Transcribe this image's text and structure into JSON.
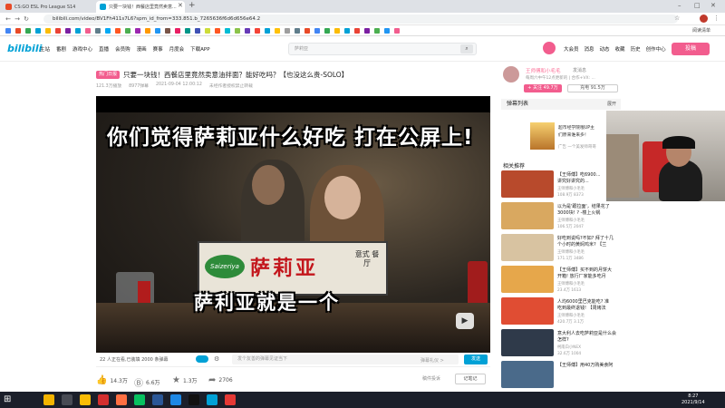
{
  "browser": {
    "tabs": [
      {
        "label": "CS:GO ESL Pro League S14",
        "color": "#e84a27"
      },
      {
        "label": "只要一块钱！西餐店里竟然卖意...",
        "color": "#00a1d6"
      }
    ],
    "url": "bilibili.com/video/BV1Fh411s7L6?spm_id_from=333.851.b_7265636f6d6d656e64.2",
    "bookmark_colors": [
      "#4285f4",
      "#e84a27",
      "#34a853",
      "#00a1d6",
      "#fbbc05",
      "#ea4335",
      "#7b1fa2",
      "#00a1d6",
      "#f25d8e",
      "#607d8b",
      "#03a9f4",
      "#ff5722",
      "#4caf50",
      "#9c27b0",
      "#ff9800",
      "#2196f3",
      "#795548",
      "#e91e63",
      "#009688",
      "#3f51b5",
      "#cddc39",
      "#ff5722",
      "#00bcd4",
      "#8bc34a",
      "#673ab7",
      "#f44336",
      "#00a1d6",
      "#ffc107",
      "#9e9e9e",
      "#607d8b",
      "#e84a27",
      "#4285f4",
      "#34a853",
      "#fbbc05",
      "#00a1d6",
      "#ea4335",
      "#7b1fa2",
      "#4caf50",
      "#2196f3",
      "#f25d8e"
    ],
    "reading_list": "阅读清单"
  },
  "header": {
    "logo": "bilibili",
    "nav": [
      "主站",
      "番剧",
      "游戏中心",
      "直播",
      "会员购",
      "漫画",
      "赛事",
      "月度会",
      "下载APP"
    ],
    "search_placeholder": "萨莉亚",
    "right_nav": [
      "大会员",
      "消息",
      "动态",
      "收藏",
      "历史",
      "创作中心"
    ],
    "upload": "投稿"
  },
  "video": {
    "badge": "热门日报",
    "title": "只要一块钱！西餐店里竟然卖意油拌面？能好吃吗？【也没这么贵-SOLO】",
    "meta": [
      "121.3万播放",
      "8977弹幕",
      "2021-09-04 12:00:12",
      "未经作者授权禁止转载"
    ],
    "big_caption": "你们觉得萨莉亚什么好吃 打在公屏上!",
    "sign_logo": "Saizeriya",
    "sign_name": "萨莉亚",
    "sign_sub": "意式 餐厅",
    "subtitle": "萨利亚就是一个"
  },
  "danmaku": {
    "count": "22 人正在看,已装填 2000 条弹幕",
    "placeholder": "发个友善的弹幕见证当下",
    "etiquette": "弹幕礼仪 >",
    "send": "发送"
  },
  "toolbar": {
    "like": "14.3万",
    "coin": "6.6万",
    "fav": "1.3万",
    "share": "2706",
    "report": "稿件投诉",
    "note": "记笔记"
  },
  "uploader": {
    "name": "王师傅和小毛毛",
    "message": "发消息",
    "desc": "每周六中午12点更新的 | 合作+VX: ...",
    "follow": "+ 关注 49.7万",
    "charge": "充电 91.5万"
  },
  "danmaku_list": {
    "label": "弹幕列表",
    "expand": "展开"
  },
  "ad": {
    "line1": "超市经学院哦UP主",
    "line2": "们原来谁来多！",
    "badge": "广告 一个美发师哥哥"
  },
  "recommend": {
    "title": "相关推荐",
    "items": [
      {
        "t1": "【王师傅】吃6900...",
        "t2": "讲究好讲究的...",
        "up": "王师傅和小毛毛",
        "stats": "108.9万 8373",
        "color": "#b84a2c"
      },
      {
        "t1": "以为是'跟拉面'，结果花了",
        "t2": "3000块! ? -楼上火锅",
        "up": "王师傅和小毛毛",
        "stats": "106.5万 2047",
        "color": "#d9a860"
      },
      {
        "t1": "好吃到说吗?不如? 拜了十几",
        "t2": "个小时的黄焖鸡米? 【兰",
        "up": "王师傅和小毛毛",
        "stats": "171.1万 3486",
        "color": "#d8c3a1"
      },
      {
        "t1": "【王师傅】买不到的月饼大",
        "t2": "开箱! 放行厂家能多吃月",
        "up": "王师傅和小毛毛",
        "stats": "23.4万 1613",
        "color": "#e6a74b"
      },
      {
        "t1": "人均6000里巴克能吃? 准",
        "t2": "吃到最终退钱! 【周烤法",
        "up": "王师傅和小毛毛",
        "stats": "420.7万 3.1万",
        "color": "#e04d33"
      },
      {
        "t1": "意大利人去吃萨莉亚是什么会",
        "t2": "怎样?",
        "up": "柯南白小NEX",
        "stats": "32.6万 1004",
        "color": "#2f3a4a"
      },
      {
        "t1": "【王师傅】用40万购美食阿",
        "t2": "",
        "up": "",
        "stats": "",
        "color": "#4a6a8a"
      }
    ]
  },
  "taskbar": {
    "apps": [
      "#f4b400",
      "#fff3",
      "#fbbc05",
      "#d32f2f",
      "#ff7043",
      "#07c160",
      "#2b5797",
      "#1e88e5",
      "#111",
      "#00a1d6",
      "#e53935"
    ],
    "time": "8:27",
    "date": "2021/9/14"
  }
}
